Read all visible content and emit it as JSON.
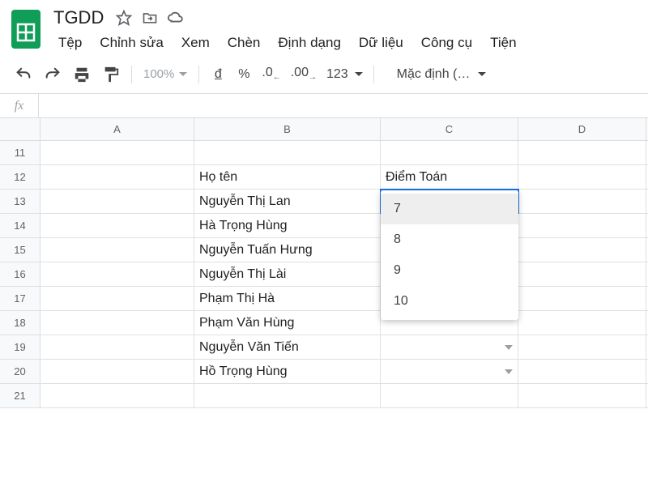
{
  "doc": {
    "title": "TGDD"
  },
  "menus": [
    "Tệp",
    "Chỉnh sửa",
    "Xem",
    "Chèn",
    "Định dạng",
    "Dữ liệu",
    "Công cụ",
    "Tiện"
  ],
  "toolbar": {
    "zoom": "100%",
    "currency": "đ",
    "percent": "%",
    "dec_dec": ".0",
    "inc_dec": ".00",
    "num_fmt": "123",
    "font": "Mặc định (…"
  },
  "formula_bar": {
    "fx": "fx",
    "value": ""
  },
  "columns": [
    "A",
    "B",
    "C",
    "D"
  ],
  "rows": [
    11,
    12,
    13,
    14,
    15,
    16,
    17,
    18,
    19,
    20,
    21
  ],
  "cells": {
    "B12": "Họ tên",
    "C12": "Điểm Toán",
    "B13": "Nguyễn Thị Lan",
    "B14": "Hà Trọng Hùng",
    "B15": "Nguyễn Tuấn Hưng",
    "B16": "Nguyễn Thị Lài",
    "B17": "Phạm Thị Hà",
    "B18": "Phạm Văn Hùng",
    "B19": "Nguyễn Văn Tiến",
    "B20": "Hồ Trọng Hùng"
  },
  "active_cell": "C13",
  "dropdown": {
    "options": [
      "7",
      "8",
      "9",
      "10"
    ],
    "hovered_index": 0
  }
}
